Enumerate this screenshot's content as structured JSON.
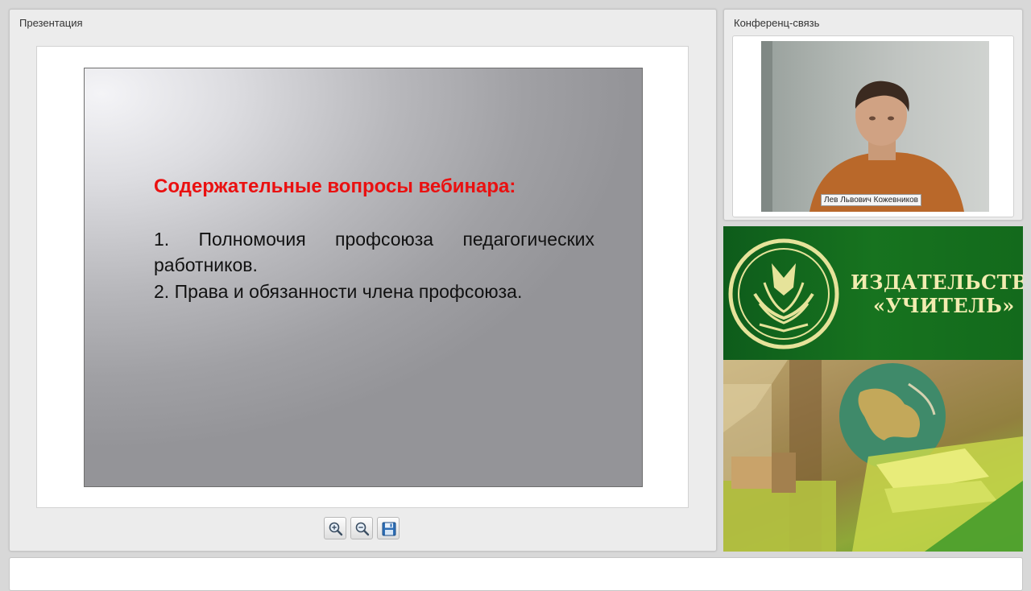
{
  "presentation": {
    "panel_title": "Презентация",
    "slide": {
      "heading": "Содержательные вопросы вебинара:",
      "lines": [
        "1. Полномочия профсоюза педагогических",
        "работников.",
        "2. Права и обязанности члена профсоюза."
      ]
    },
    "toolbar": {
      "zoom_in_icon": "zoom-in-icon",
      "zoom_out_icon": "zoom-out-icon",
      "save_icon": "floppy-disk-icon"
    }
  },
  "conference": {
    "panel_title": "Конференц-связь",
    "speaker_name": "Лев Львович Кожевников"
  },
  "banner": {
    "line1": "ИЗДАТЕЛЬСТВО",
    "line2": "«УЧИТЕЛЬ»"
  },
  "colors": {
    "slide_heading": "#ea1010",
    "banner_green": "#17731f",
    "banner_text": "#f2ecb0"
  }
}
